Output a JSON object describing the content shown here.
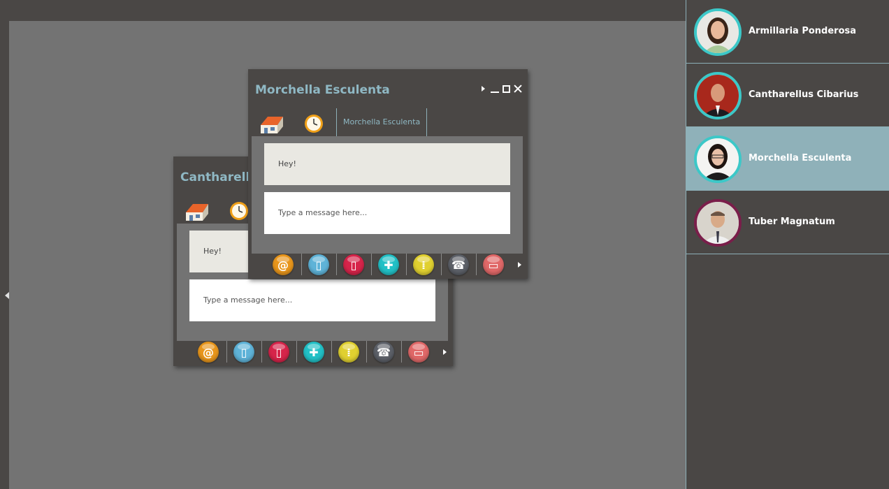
{
  "contacts": [
    {
      "name": "Armillaria Ponderosa",
      "active": false
    },
    {
      "name": "Cantharellus Cibarius",
      "active": false
    },
    {
      "name": "Morchella Esculenta",
      "active": true
    },
    {
      "name": "Tuber Magnatum",
      "active": false
    }
  ],
  "windows": {
    "back": {
      "title": "Cantharellus Cibarius",
      "message": "Hey!",
      "input_placeholder": "Type a message here..."
    },
    "front": {
      "title": "Morchella Esculenta",
      "tab_name": "Morchella Esculenta",
      "message": "Hey!",
      "input_placeholder": "Type a message here..."
    }
  },
  "toolbar": {
    "icons": [
      "email-icon",
      "document-icon",
      "mobile-icon",
      "grid-icon",
      "audio-icon",
      "phone-icon",
      "tv-icon"
    ],
    "colors": [
      "#e8961c",
      "#5fb3d8",
      "#d6244a",
      "#22c0c6",
      "#e0d030",
      "#5c6068",
      "#e06868"
    ]
  }
}
